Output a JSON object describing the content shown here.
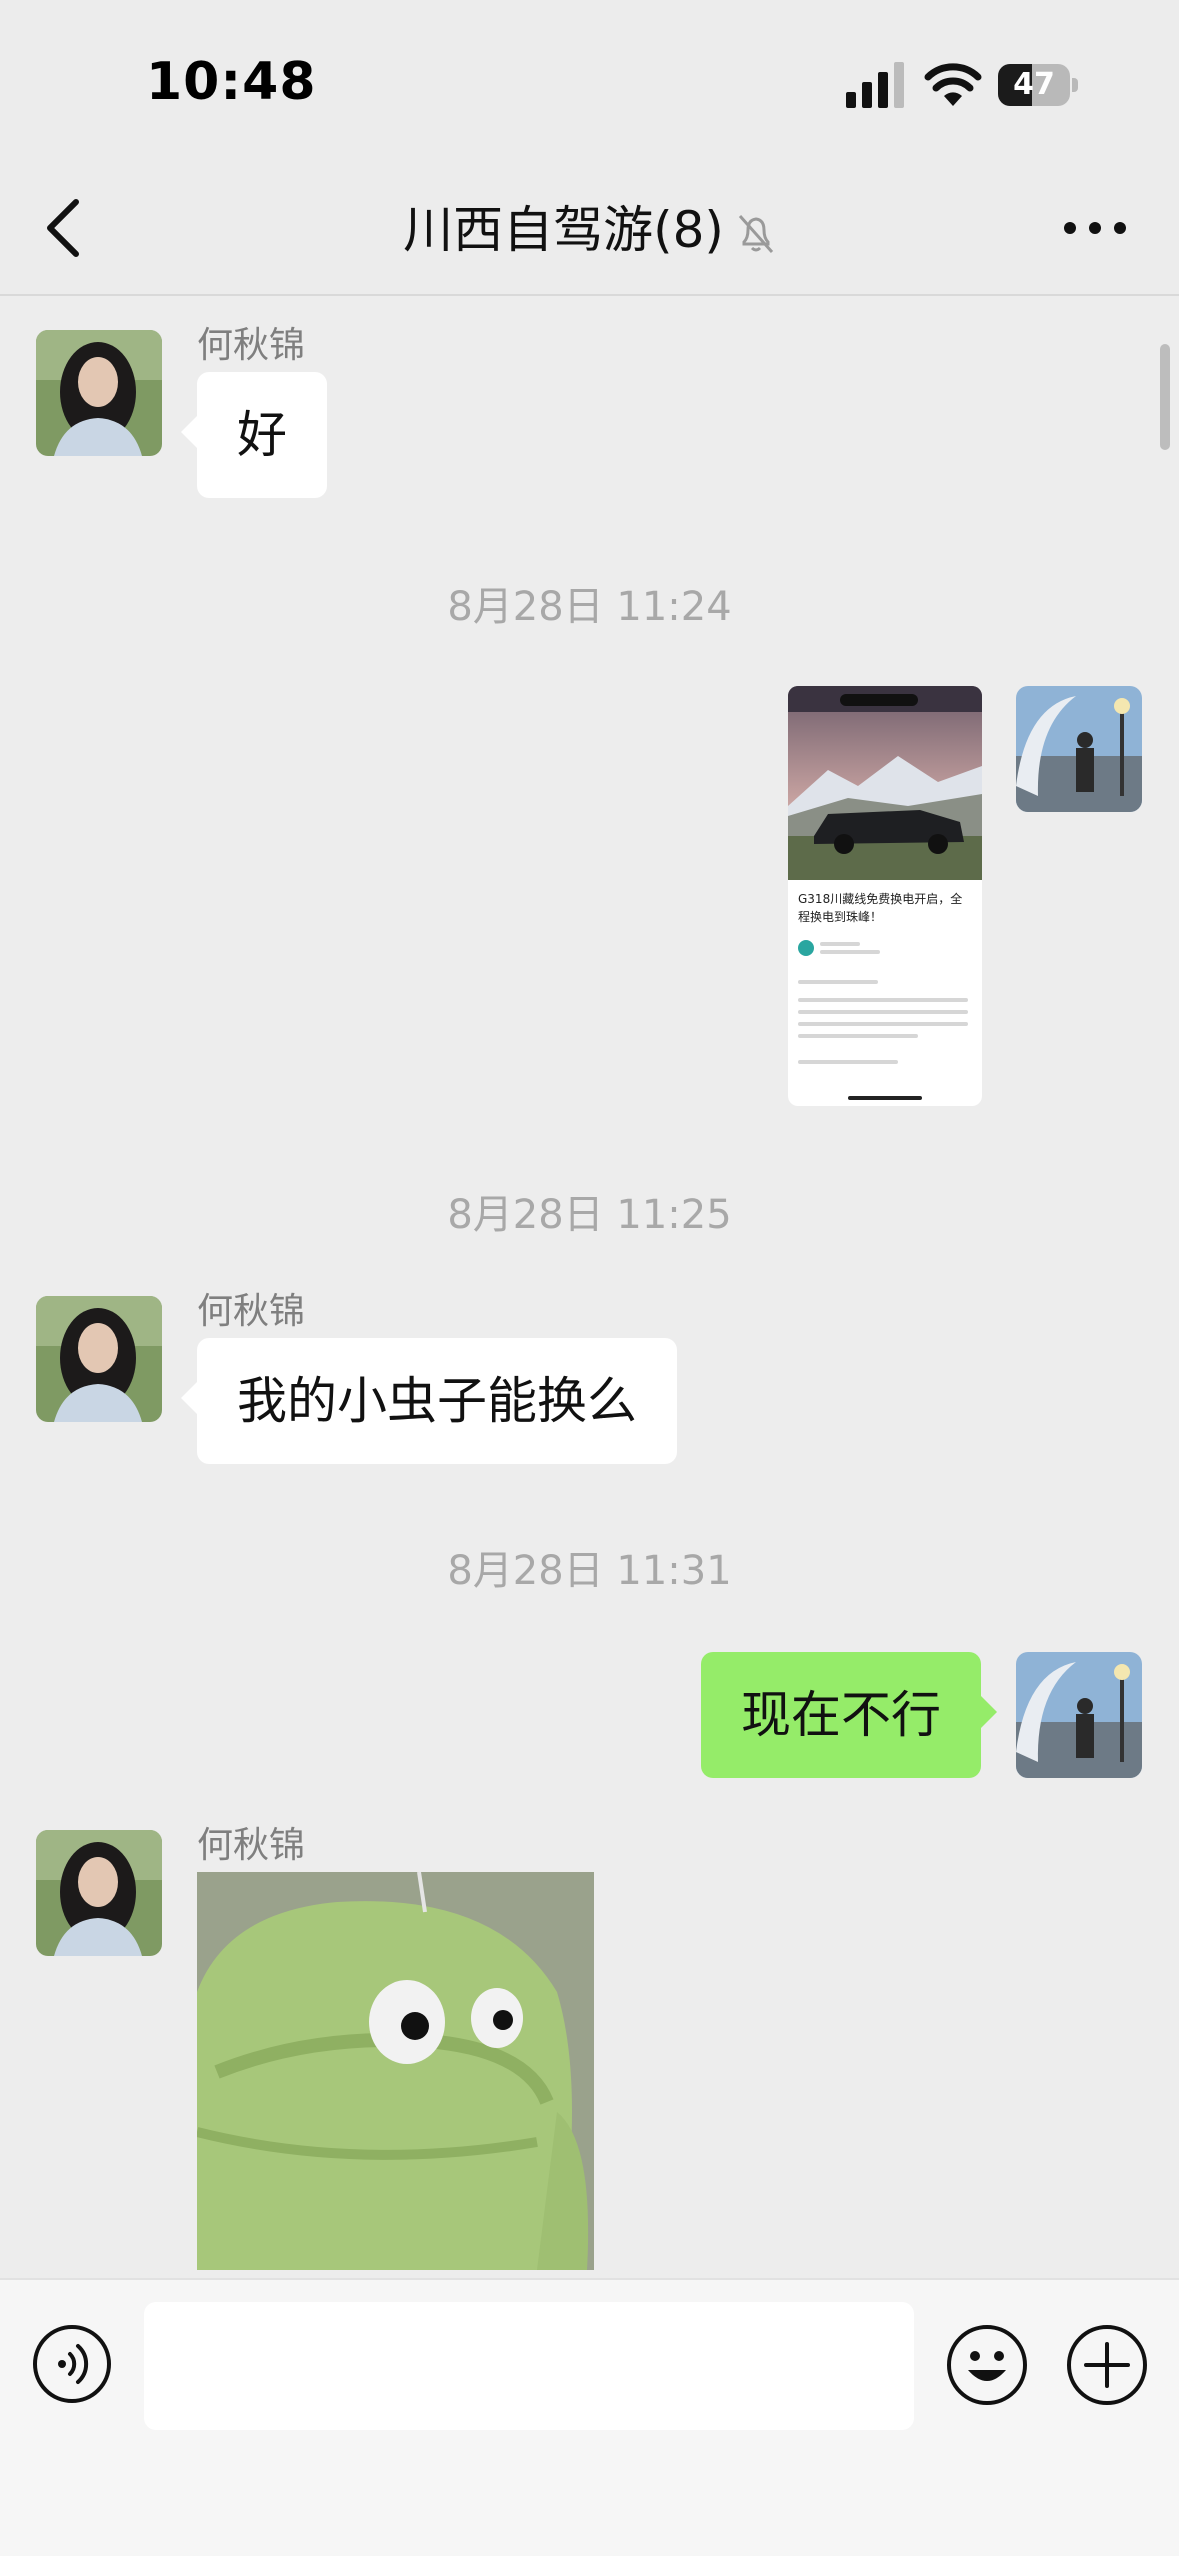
{
  "status_bar": {
    "time": "10:48",
    "battery_percent": "47",
    "battery_level": 0.47
  },
  "header": {
    "title": "川西自驾游(8)",
    "muted_icon": "bell-slash-icon",
    "back_icon": "chevron-left-icon",
    "more_icon": "ellipsis-icon"
  },
  "messages": [
    {
      "type": "text",
      "direction": "incoming",
      "sender": "何秋锦",
      "text": "好"
    },
    {
      "type": "timestamp",
      "text": "8月28日 11:24"
    },
    {
      "type": "shared-card",
      "direction": "outgoing",
      "card_title": "G318川藏线免费换电开启，全程换电到珠峰！"
    },
    {
      "type": "timestamp",
      "text": "8月28日 11:25"
    },
    {
      "type": "text",
      "direction": "incoming",
      "sender": "何秋锦",
      "text": "我的小虫子能换么"
    },
    {
      "type": "timestamp",
      "text": "8月28日 11:31"
    },
    {
      "type": "text",
      "direction": "outgoing",
      "text": "现在不行"
    },
    {
      "type": "sticker",
      "direction": "incoming",
      "sender": "何秋锦"
    }
  ],
  "input_bar": {
    "voice_icon": "voice-icon",
    "emoji_icon": "smiley-icon",
    "plus_icon": "plus-circle-icon",
    "placeholder": ""
  },
  "colors": {
    "background": "#ededed",
    "outgoing_bubble": "#95ec69",
    "incoming_bubble": "#ffffff",
    "timestamp": "#a8a8a8"
  }
}
